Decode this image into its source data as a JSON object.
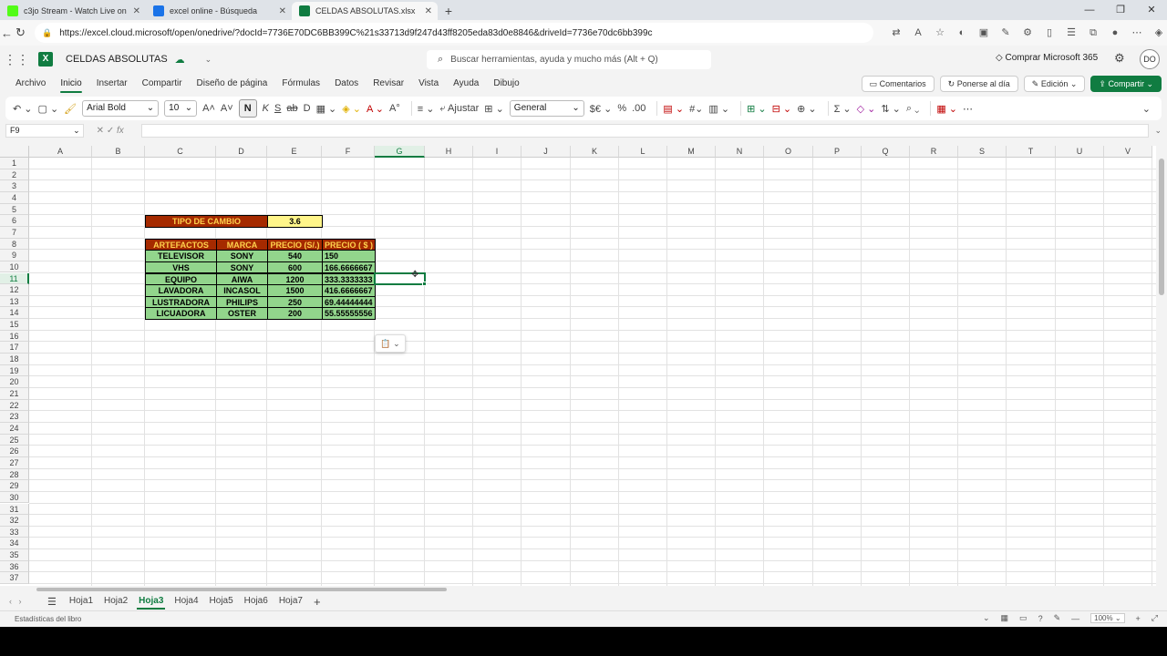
{
  "browser": {
    "tabs": [
      {
        "label": "c3jo Stream - Watch Live on",
        "color": "#53fc18"
      },
      {
        "label": "excel online - Búsqueda",
        "color": "#1a73e8"
      },
      {
        "label": "CELDAS ABSOLUTAS.xlsx",
        "color": "#107c41"
      }
    ],
    "url": "https://excel.cloud.microsoft/open/onedrive/?docId=7736E70DC6BB399C%21s33713d9f247d43ff8205eda83d0e8846&driveId=7736e70dc6bb399c"
  },
  "office": {
    "doc_name": "CELDAS ABSOLUTAS",
    "search_placeholder": "Buscar herramientas, ayuda y mucho más (Alt + Q)",
    "buy": "Comprar Microsoft 365",
    "avatar": "DO"
  },
  "ribbon": {
    "tabs": [
      "Archivo",
      "Inicio",
      "Insertar",
      "Compartir",
      "Diseño de página",
      "Fórmulas",
      "Datos",
      "Revisar",
      "Vista",
      "Ayuda",
      "Dibujo"
    ],
    "comments": "Comentarios",
    "catch_up": "Ponerse al día",
    "editing": "Edición",
    "share": "Compartir"
  },
  "toolbar": {
    "font": "Arial Bold",
    "size": "10",
    "bold": "N",
    "wrap": "Ajustar",
    "number_format": "General"
  },
  "formula": {
    "name_box": "F9",
    "fx": "fx"
  },
  "grid": {
    "columns": [
      "A",
      "B",
      "C",
      "D",
      "E",
      "F",
      "G",
      "H",
      "I",
      "J",
      "K",
      "L",
      "M",
      "N",
      "O",
      "P",
      "Q",
      "R",
      "S",
      "T",
      "U",
      "V"
    ],
    "rows": [
      "1",
      "2",
      "3",
      "4",
      "5",
      "6",
      "7",
      "8",
      "9",
      "10",
      "11",
      "12",
      "13",
      "14",
      "15",
      "16",
      "17",
      "18",
      "19",
      "20",
      "21",
      "22",
      "23",
      "24",
      "25",
      "26",
      "27",
      "28",
      "29",
      "30",
      "31",
      "32",
      "33",
      "34",
      "35",
      "36",
      "37"
    ],
    "exchange_label": "TIPO DE CAMBIO",
    "exchange_value": "3.6",
    "headers": [
      "ARTEFACTOS",
      "MARCA",
      "PRECIO (S/.)",
      "PRECIO ( $ )"
    ],
    "table": [
      [
        "TELEVISOR",
        "SONY",
        "540",
        "150"
      ],
      [
        "VHS",
        "SONY",
        "600",
        "166.6666667"
      ],
      [
        "EQUIPO",
        "AIWA",
        "1200",
        "333.3333333"
      ],
      [
        "LAVADORA",
        "INCASOL",
        "1500",
        "416.6666667"
      ],
      [
        "LUSTRADORA",
        "PHILIPS",
        "250",
        "69.44444444"
      ],
      [
        "LICUADORA",
        "OSTER",
        "200",
        "55.55555556"
      ]
    ]
  },
  "sheets": [
    "Hoja1",
    "Hoja2",
    "Hoja3",
    "Hoja4",
    "Hoja5",
    "Hoja6",
    "Hoja7"
  ],
  "status": {
    "left": "Estadísticas del libro",
    "zoom": "100%"
  }
}
